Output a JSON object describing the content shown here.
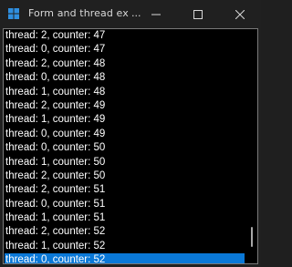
{
  "window": {
    "title": "Form and thread ex",
    "title_ellipsis": "..."
  },
  "controls": {
    "minimize_icon": "minimize-icon",
    "maximize_icon": "maximize-icon",
    "close_icon": "close-icon"
  },
  "list": {
    "items": [
      "thread: 2, counter: 47",
      "thread: 0, counter: 47",
      "thread: 2, counter: 48",
      "thread: 0, counter: 48",
      "thread: 1, counter: 48",
      "thread: 2, counter: 49",
      "thread: 1, counter: 49",
      "thread: 0, counter: 49",
      "thread: 0, counter: 50",
      "thread: 1, counter: 50",
      "thread: 2, counter: 50",
      "thread: 2, counter: 51",
      "thread: 0, counter: 51",
      "thread: 1, counter: 51",
      "thread: 2, counter: 52",
      "thread: 1, counter: 52",
      "thread: 0, counter: 52"
    ],
    "selected_index": 16
  },
  "colors": {
    "selection": "#0a78d7",
    "list_background": "#000000",
    "titlebar": "#202020",
    "app_icon": "#2f8fe0"
  }
}
